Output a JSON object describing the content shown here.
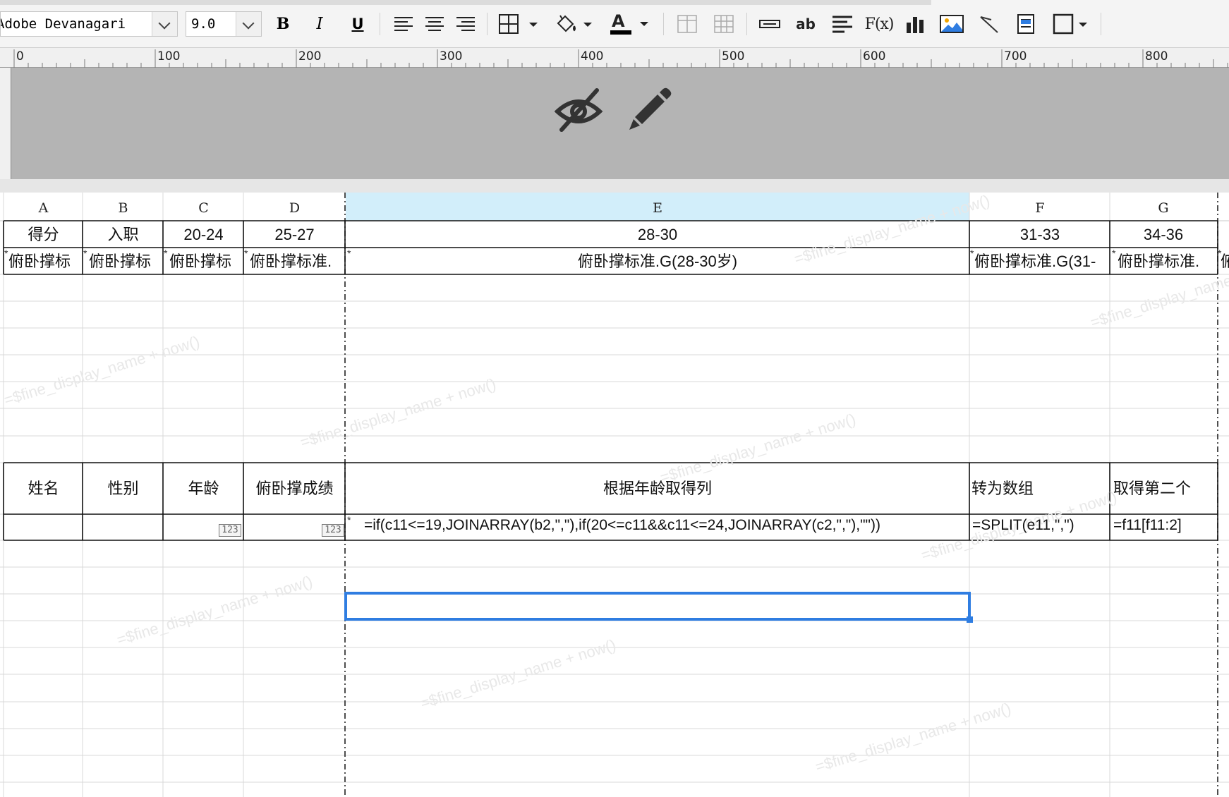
{
  "toolbar": {
    "font_name": "Adobe Devanagari",
    "font_size": "9.0",
    "bold_label": "B",
    "italic_label": "I",
    "underline_label": "U",
    "ab_label": "ab",
    "fx_label": "F(x)",
    "text_color": "#000000"
  },
  "ruler": {
    "labels": [
      "0",
      "100",
      "200",
      "300",
      "400",
      "500",
      "600",
      "700",
      "800"
    ]
  },
  "grid": {
    "column_headers": [
      "A",
      "B",
      "C",
      "D",
      "E",
      "F",
      "G"
    ],
    "selected_column": "E",
    "row1": [
      "得分",
      "入职",
      "20-24",
      "25-27",
      "28-30",
      "31-33",
      "34-36"
    ],
    "row2": [
      "俯卧撑标",
      "俯卧撑标",
      "俯卧撑标",
      "俯卧撑标准.",
      "俯卧撑标准.G(28-30岁)",
      "俯卧撑标准.G(31-",
      "俯卧撑标准.",
      "俯"
    ],
    "label_row": [
      "姓名",
      "性别",
      "年龄",
      "俯卧撑成绩",
      "根据年龄取得列",
      "转为数组",
      "取得第二个"
    ],
    "formula_row": {
      "c_icon": "123",
      "d_icon": "123",
      "e": "=if(c11<=19,JOINARRAY(b2,\",\"),if(20<=c11&&c11<=24,JOINARRAY(c2,\",\"),\"\"))",
      "f": "=SPLIT(e11,\",\")",
      "g": "=f11[f11:2]"
    },
    "watermark": "=$fine_display_name + now()",
    "selection_color": "#2f7de1",
    "header_highlight": "#d2eefa"
  },
  "header_area": {
    "icons": [
      "eye-slash-icon",
      "pencil-icon"
    ]
  }
}
